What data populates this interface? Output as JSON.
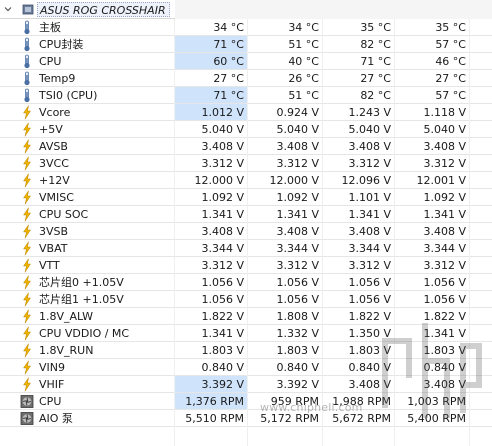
{
  "header": {
    "title": "ASUS ROG CROSSHAIR ..."
  },
  "rows": [
    {
      "icon": "thermometer",
      "label": "主板",
      "v1": "34 °C",
      "v2": "34 °C",
      "v3": "35 °C",
      "v4": "35 °C",
      "hl": false
    },
    {
      "icon": "thermometer",
      "label": "CPU封装",
      "v1": "71 °C",
      "v2": "51 °C",
      "v3": "82 °C",
      "v4": "57 °C",
      "hl": true
    },
    {
      "icon": "thermometer",
      "label": "CPU",
      "v1": "60 °C",
      "v2": "40 °C",
      "v3": "71 °C",
      "v4": "46 °C",
      "hl": true
    },
    {
      "icon": "thermometer",
      "label": "Temp9",
      "v1": "27 °C",
      "v2": "26 °C",
      "v3": "27 °C",
      "v4": "27 °C",
      "hl": false
    },
    {
      "icon": "thermometer",
      "label": "TSI0 (CPU)",
      "v1": "71 °C",
      "v2": "51 °C",
      "v3": "82 °C",
      "v4": "57 °C",
      "hl": true
    },
    {
      "icon": "lightning",
      "label": "Vcore",
      "v1": "1.012 V",
      "v2": "0.924 V",
      "v3": "1.243 V",
      "v4": "1.118 V",
      "hl": true
    },
    {
      "icon": "lightning",
      "label": "+5V",
      "v1": "5.040 V",
      "v2": "5.040 V",
      "v3": "5.040 V",
      "v4": "5.040 V",
      "hl": false
    },
    {
      "icon": "lightning",
      "label": "AVSB",
      "v1": "3.408 V",
      "v2": "3.408 V",
      "v3": "3.408 V",
      "v4": "3.408 V",
      "hl": false
    },
    {
      "icon": "lightning",
      "label": "3VCC",
      "v1": "3.312 V",
      "v2": "3.312 V",
      "v3": "3.312 V",
      "v4": "3.312 V",
      "hl": false
    },
    {
      "icon": "lightning",
      "label": "+12V",
      "v1": "12.000 V",
      "v2": "12.000 V",
      "v3": "12.096 V",
      "v4": "12.001 V",
      "hl": false
    },
    {
      "icon": "lightning",
      "label": "VMISC",
      "v1": "1.092 V",
      "v2": "1.092 V",
      "v3": "1.101 V",
      "v4": "1.092 V",
      "hl": false
    },
    {
      "icon": "lightning",
      "label": "CPU SOC",
      "v1": "1.341 V",
      "v2": "1.341 V",
      "v3": "1.341 V",
      "v4": "1.341 V",
      "hl": false
    },
    {
      "icon": "lightning",
      "label": "3VSB",
      "v1": "3.408 V",
      "v2": "3.408 V",
      "v3": "3.408 V",
      "v4": "3.408 V",
      "hl": false
    },
    {
      "icon": "lightning",
      "label": "VBAT",
      "v1": "3.344 V",
      "v2": "3.344 V",
      "v3": "3.344 V",
      "v4": "3.344 V",
      "hl": false
    },
    {
      "icon": "lightning",
      "label": "VTT",
      "v1": "3.312 V",
      "v2": "3.312 V",
      "v3": "3.312 V",
      "v4": "3.312 V",
      "hl": false
    },
    {
      "icon": "lightning",
      "label": "芯片组0 +1.05V",
      "v1": "1.056 V",
      "v2": "1.056 V",
      "v3": "1.056 V",
      "v4": "1.056 V",
      "hl": false
    },
    {
      "icon": "lightning",
      "label": "芯片组1 +1.05V",
      "v1": "1.056 V",
      "v2": "1.056 V",
      "v3": "1.056 V",
      "v4": "1.056 V",
      "hl": false
    },
    {
      "icon": "lightning",
      "label": "1.8V_ALW",
      "v1": "1.822 V",
      "v2": "1.808 V",
      "v3": "1.822 V",
      "v4": "1.822 V",
      "hl": false
    },
    {
      "icon": "lightning",
      "label": "CPU VDDIO / MC",
      "v1": "1.341 V",
      "v2": "1.332 V",
      "v3": "1.350 V",
      "v4": "1.341 V",
      "hl": false
    },
    {
      "icon": "lightning",
      "label": "1.8V_RUN",
      "v1": "1.803 V",
      "v2": "1.803 V",
      "v3": "1.803 V",
      "v4": "1.803 V",
      "hl": false
    },
    {
      "icon": "lightning",
      "label": "VIN9",
      "v1": "0.840 V",
      "v2": "0.840 V",
      "v3": "0.840 V",
      "v4": "0.840 V",
      "hl": false
    },
    {
      "icon": "lightning",
      "label": "VHIF",
      "v1": "3.392 V",
      "v2": "3.392 V",
      "v3": "3.408 V",
      "v4": "3.408 V",
      "hl": true
    },
    {
      "icon": "fan",
      "label": "CPU",
      "v1": "1,376 RPM",
      "v2": "959 RPM",
      "v3": "1,988 RPM",
      "v4": "1,003 RPM",
      "hl": true
    },
    {
      "icon": "fan",
      "label": "AIO 泵",
      "v1": "5,510 RPM",
      "v2": "5,172 RPM",
      "v3": "5,672 RPM",
      "v4": "5,400 RPM",
      "hl": false
    }
  ],
  "watermark": {
    "text": "www.chiphell.com"
  },
  "colors": {
    "highlight": "#cfe3fb",
    "lightning": "#f0b400",
    "thermo": "#4a6fa5"
  }
}
